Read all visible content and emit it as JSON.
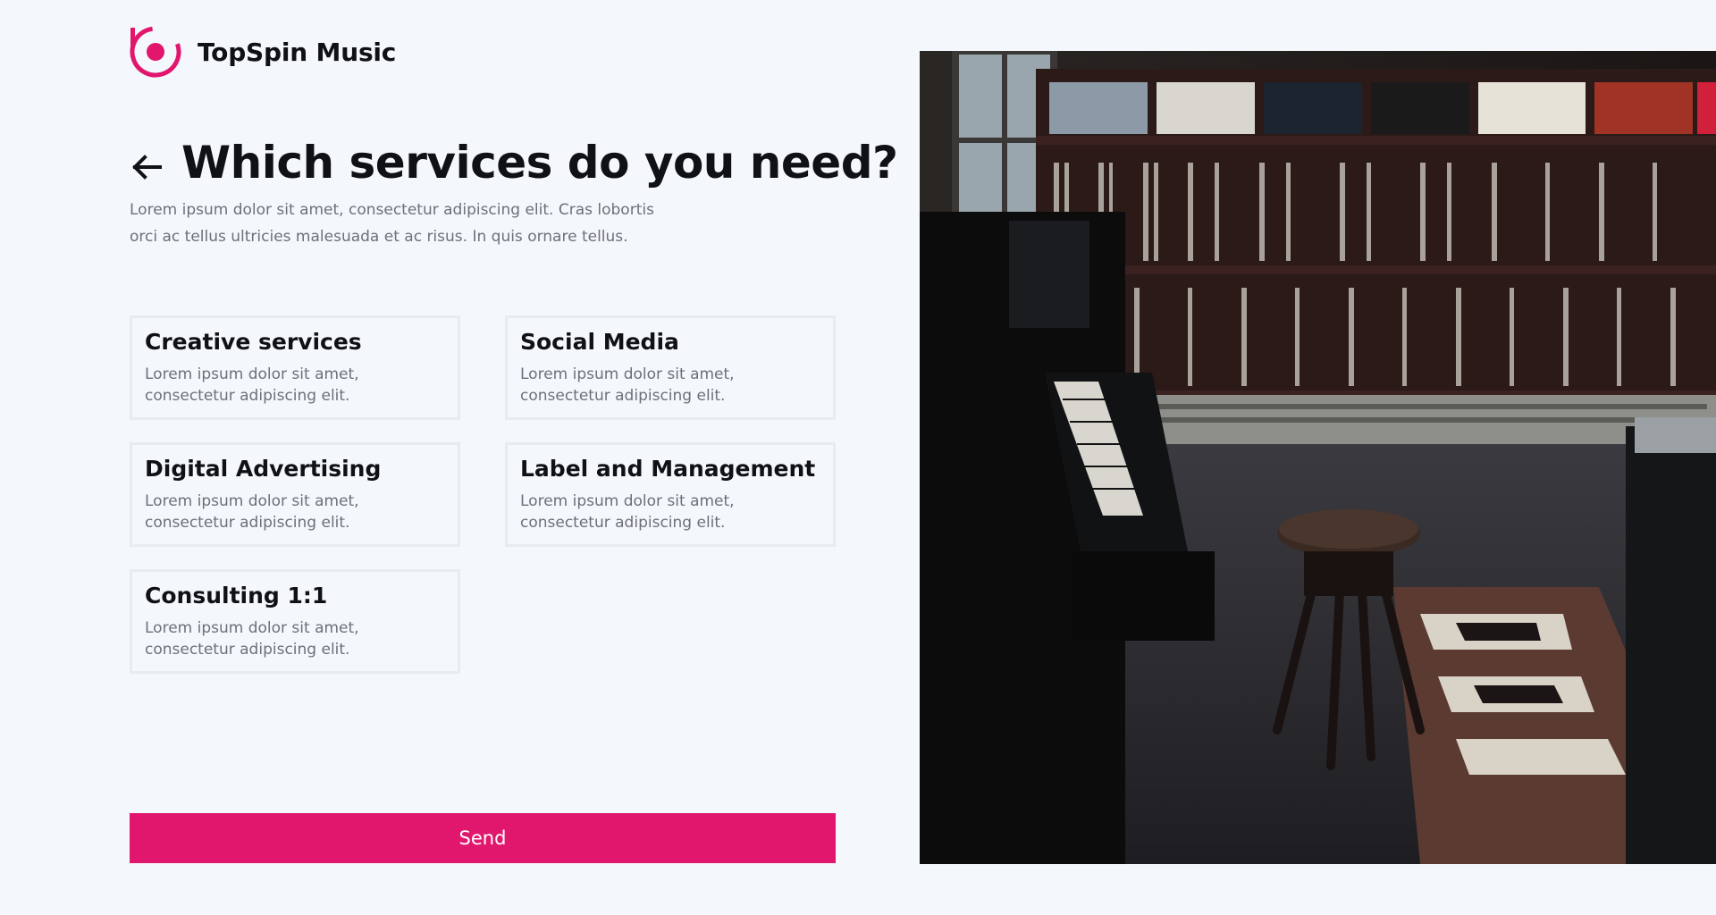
{
  "brand": {
    "name": "TopSpin Music",
    "logo_icon": "topspin-logo-icon",
    "accent_color": "#e0176d"
  },
  "header": {
    "title": "Which services do you need?",
    "back_icon": "arrow-left-icon",
    "intro": "Lorem ipsum dolor sit amet, consectetur adipiscing elit. Cras lobortis orci ac tellus ultricies malesuada et ac risus. In quis ornare tellus."
  },
  "services": [
    {
      "title": "Creative services",
      "description": "Lorem ipsum dolor sit amet, consectetur adipiscing elit."
    },
    {
      "title": "Social Media",
      "description": "Lorem ipsum dolor sit amet, consectetur adipiscing elit."
    },
    {
      "title": "Digital Advertising",
      "description": "Lorem ipsum dolor sit amet, consectetur adipiscing elit."
    },
    {
      "title": "Label and Management",
      "description": "Lorem ipsum dolor sit amet, consectetur adipiscing elit."
    },
    {
      "title": "Consulting 1:1",
      "description": "Lorem ipsum dolor sit amet, consectetur adipiscing elit."
    }
  ],
  "actions": {
    "send_label": "Send"
  },
  "photo": {
    "subject": "record-store-piano-photo"
  }
}
